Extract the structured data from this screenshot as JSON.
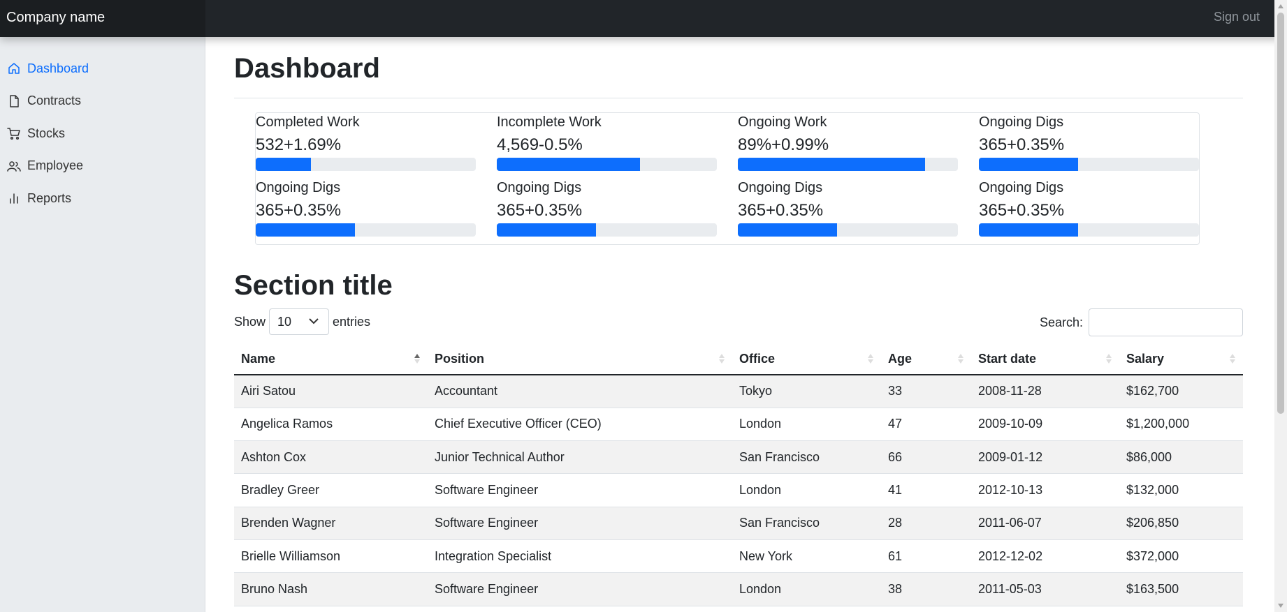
{
  "header": {
    "brand": "Company name",
    "signout": "Sign out"
  },
  "sidebar": {
    "items": [
      {
        "label": "Dashboard",
        "icon": "home-icon",
        "active": true
      },
      {
        "label": "Contracts",
        "icon": "file-icon",
        "active": false
      },
      {
        "label": "Stocks",
        "icon": "cart-icon",
        "active": false
      },
      {
        "label": "Employee",
        "icon": "users-icon",
        "active": false
      },
      {
        "label": "Reports",
        "icon": "bar-chart-icon",
        "active": false
      }
    ]
  },
  "page": {
    "title": "Dashboard"
  },
  "stats": [
    {
      "title": "Completed Work",
      "value": "532+1.69%",
      "progress": 25
    },
    {
      "title": "Incomplete Work",
      "value": "4,569-0.5%",
      "progress": 65
    },
    {
      "title": "Ongoing Work",
      "value": "89%+0.99%",
      "progress": 85
    },
    {
      "title": "Ongoing Digs",
      "value": "365+0.35%",
      "progress": 45
    },
    {
      "title": "Ongoing Digs",
      "value": "365+0.35%",
      "progress": 45
    },
    {
      "title": "Ongoing Digs",
      "value": "365+0.35%",
      "progress": 45
    },
    {
      "title": "Ongoing Digs",
      "value": "365+0.35%",
      "progress": 45
    },
    {
      "title": "Ongoing Digs",
      "value": "365+0.35%",
      "progress": 45
    }
  ],
  "section": {
    "title": "Section title"
  },
  "controls": {
    "show_label": "Show",
    "entries_value": "10",
    "entries_label": "entries",
    "search_label": "Search:",
    "search_value": ""
  },
  "table": {
    "columns": [
      "Name",
      "Position",
      "Office",
      "Age",
      "Start date",
      "Salary"
    ],
    "rows": [
      [
        "Airi Satou",
        "Accountant",
        "Tokyo",
        "33",
        "2008-11-28",
        "$162,700"
      ],
      [
        "Angelica Ramos",
        "Chief Executive Officer (CEO)",
        "London",
        "47",
        "2009-10-09",
        "$1,200,000"
      ],
      [
        "Ashton Cox",
        "Junior Technical Author",
        "San Francisco",
        "66",
        "2009-01-12",
        "$86,000"
      ],
      [
        "Bradley Greer",
        "Software Engineer",
        "London",
        "41",
        "2012-10-13",
        "$132,000"
      ],
      [
        "Brenden Wagner",
        "Software Engineer",
        "San Francisco",
        "28",
        "2011-06-07",
        "$206,850"
      ],
      [
        "Brielle Williamson",
        "Integration Specialist",
        "New York",
        "61",
        "2012-12-02",
        "$372,000"
      ],
      [
        "Bruno Nash",
        "Software Engineer",
        "London",
        "38",
        "2011-05-03",
        "$163,500"
      ]
    ]
  },
  "colors": {
    "accent": "#0d6efd",
    "topbar": "#212529",
    "sidebar": "#e9ecef"
  }
}
